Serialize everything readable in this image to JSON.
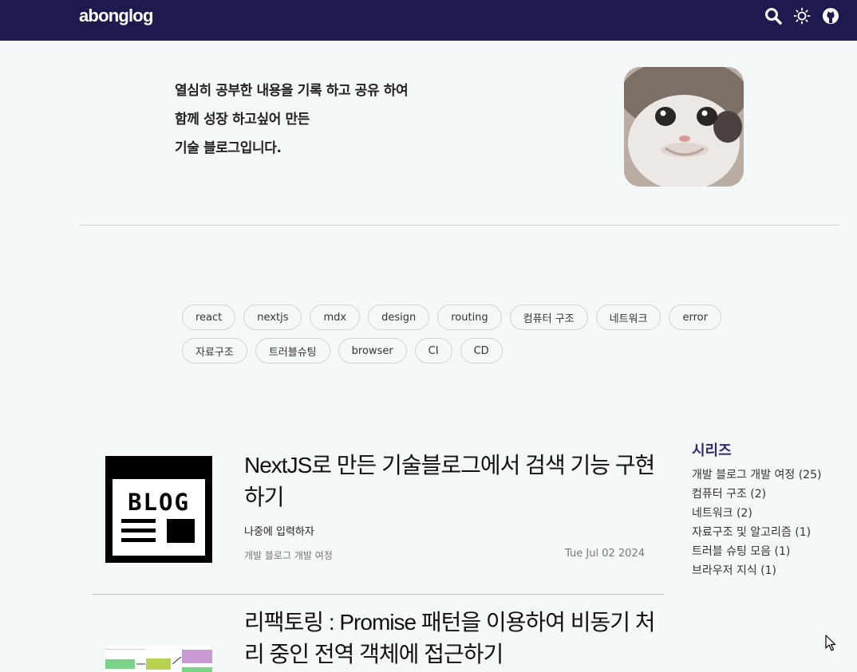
{
  "header": {
    "logo": "abonglog",
    "icons": [
      "search-icon",
      "sun-icon",
      "github-icon"
    ]
  },
  "intro": {
    "lines": [
      "열심히 공부한 내용을 기록 하고 공유 하여",
      "함께 성장 하고싶어 만든",
      "기술 블로그입니다."
    ]
  },
  "tags": {
    "row1": [
      "react",
      "nextjs",
      "mdx",
      "design",
      "routing",
      "컴퓨터 구조",
      "네트워크",
      "error"
    ],
    "row2": [
      "자료구조",
      "트러블슈팅",
      "browser",
      "CI",
      "CD"
    ]
  },
  "posts": [
    {
      "title": "NextJS로 만든 기술블로그에서 검색 기능 구현하기",
      "description": "나중에 입력하자",
      "category": "개발 블로그 개발 여정",
      "date": "Tue Jul 02 2024",
      "thumbnail_text": "BLOG"
    },
    {
      "title": "리팩토링 : Promise 패턴을 이용하여 비동기 처리 중인 전역 객체에 접근하기"
    }
  ],
  "sidebar": {
    "title": "시리즈",
    "items": [
      "개발 블로그 개발 여정 (25)",
      "컴퓨터 구조 (2)",
      "네트워크 (2)",
      "자료구조 및 알고리즘 (1)",
      "트러블 슈팅 모음 (1)",
      "브라우저 지식 (1)"
    ]
  },
  "colors": {
    "header_bg": "#1d1a4e",
    "page_bg": "#f5f8f8",
    "series_title": "#2f2a6b"
  }
}
